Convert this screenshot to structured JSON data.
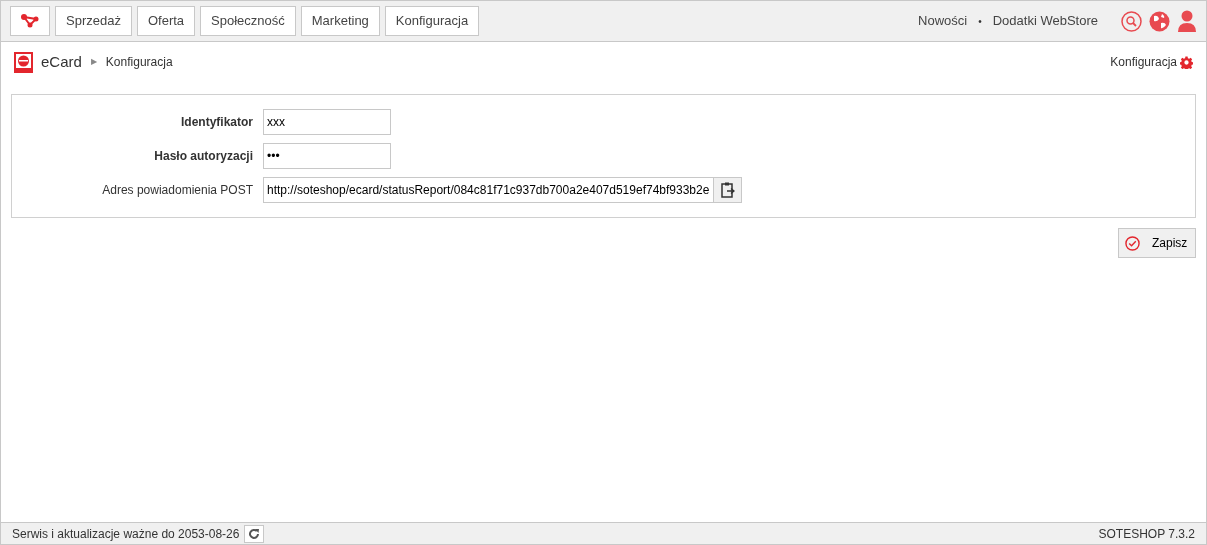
{
  "nav": {
    "tabs": [
      "Sprzedaż",
      "Oferta",
      "Społeczność",
      "Marketing",
      "Konfiguracja"
    ],
    "links": [
      "Nowości",
      "Dodatki WebStore"
    ],
    "separator": "•"
  },
  "breadcrumb": {
    "module": "eCard",
    "arrow": "▶",
    "page": "Konfiguracja",
    "settings_link": "Konfiguracja"
  },
  "form": {
    "fields": [
      {
        "label": "Identyfikator",
        "bold": true,
        "value": "xxx",
        "kind": "text"
      },
      {
        "label": "Hasło autoryzacji",
        "bold": true,
        "value": "•••",
        "kind": "text"
      },
      {
        "label": "Adres powiadomienia POST",
        "bold": false,
        "value": "http://soteshop/ecard/statusReport/084c81f71c937db700a2e407d519ef74bf933b2e",
        "kind": "copy"
      }
    ]
  },
  "save_button": "Zapisz",
  "status_bar": {
    "license": "Serwis i aktualizacje ważne do 2053-08-26",
    "version": "SOTESHOP 7.3.2"
  }
}
